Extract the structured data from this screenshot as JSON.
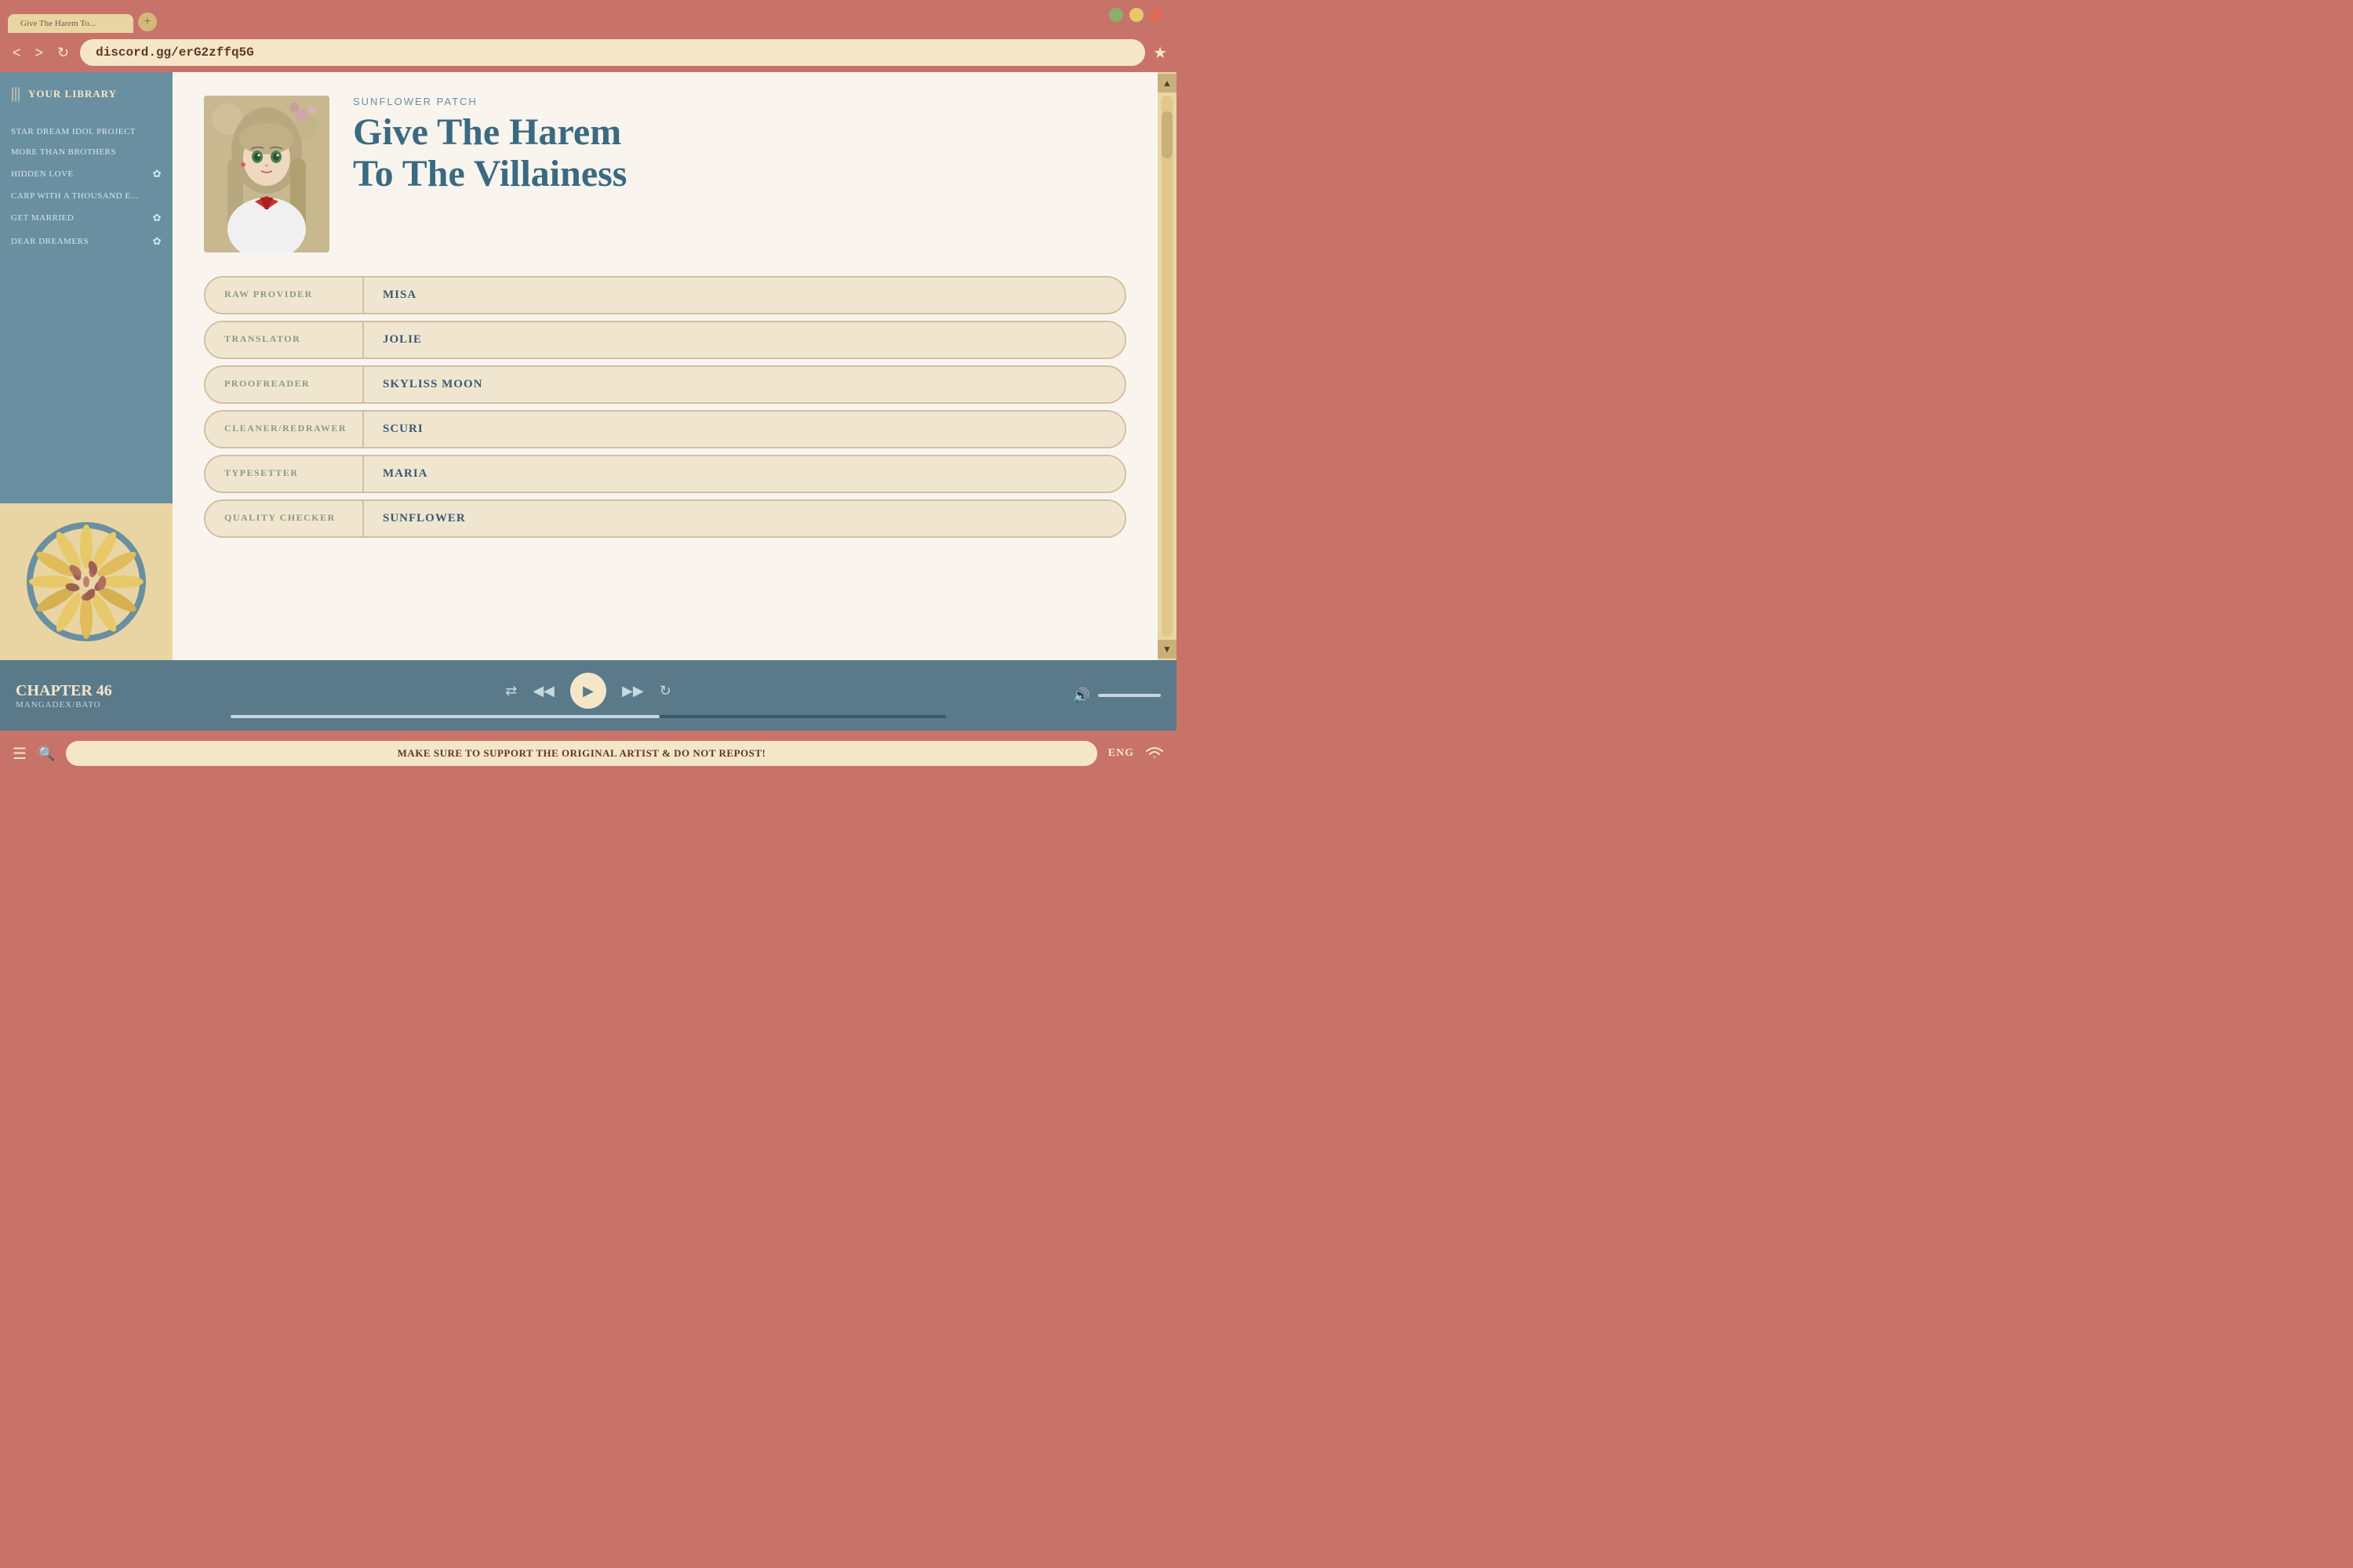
{
  "browser": {
    "tab_label": "Give The Harem To...",
    "tab_add_icon": "+",
    "url": "discord.gg/erG2zffq5G",
    "nav_back": "<",
    "nav_forward": ">",
    "nav_refresh": "↻",
    "nav_star": "★",
    "scroll_up": "▲",
    "scroll_down": "▼"
  },
  "sidebar": {
    "icon": "|||",
    "title": "YOUR LIBRARY",
    "items": [
      {
        "label": "STAR DREAM IDOL PROJECT",
        "heart": false
      },
      {
        "label": "MORE THAN BROTHERS",
        "heart": false
      },
      {
        "label": "HIDDEN LOVE",
        "heart": true
      },
      {
        "label": "CARP WITH A THOUSAND E...",
        "heart": false
      },
      {
        "label": "GET MARRIED",
        "heart": true
      },
      {
        "label": "DEAR DREAMERS",
        "heart": true
      }
    ]
  },
  "manga": {
    "subtitle": "SUNFLOWER PATCH",
    "title_line1": "Give The Harem",
    "title_line2": "To The Villainess"
  },
  "credits": [
    {
      "role": "RAW PROVIDER",
      "name": "MISA"
    },
    {
      "role": "TRANSLATOR",
      "name": "JOLIE"
    },
    {
      "role": "PROOFREADER",
      "name": "SKYLISS MOON"
    },
    {
      "role": "CLEANER/REDRAWER",
      "name": "SCURI"
    },
    {
      "role": "TYPESETTER",
      "name": "MARIA"
    },
    {
      "role": "QUALITY CHECKER",
      "name": "SUNFLOWER"
    }
  ],
  "player": {
    "chapter": "CHAPTER 46",
    "source": "MANGADEX/BATO",
    "shuffle_icon": "⇄",
    "prev_icon": "◀◀",
    "play_icon": "▶",
    "next_icon": "▶▶",
    "repeat_icon": "↻",
    "volume_icon": "🔊",
    "progress_percent": 60
  },
  "bottom_bar": {
    "notice": "MAKE SURE TO SUPPORT THE ORIGINAL ARTIST & DO NOT REPOST!",
    "language": "ENG",
    "menu_icon": "☰",
    "search_icon": "🔍",
    "wifi_icon": "wifi"
  },
  "colors": {
    "primary_bg": "#c8736a",
    "sidebar_bg": "#6a8fa0",
    "content_bg": "#f9f5ee",
    "player_bg": "#5a7a8a",
    "accent": "#f5e6c8",
    "title_color": "#3a6a80",
    "credit_bg": "#f0e6d0",
    "credit_border": "#d0c0a0"
  }
}
